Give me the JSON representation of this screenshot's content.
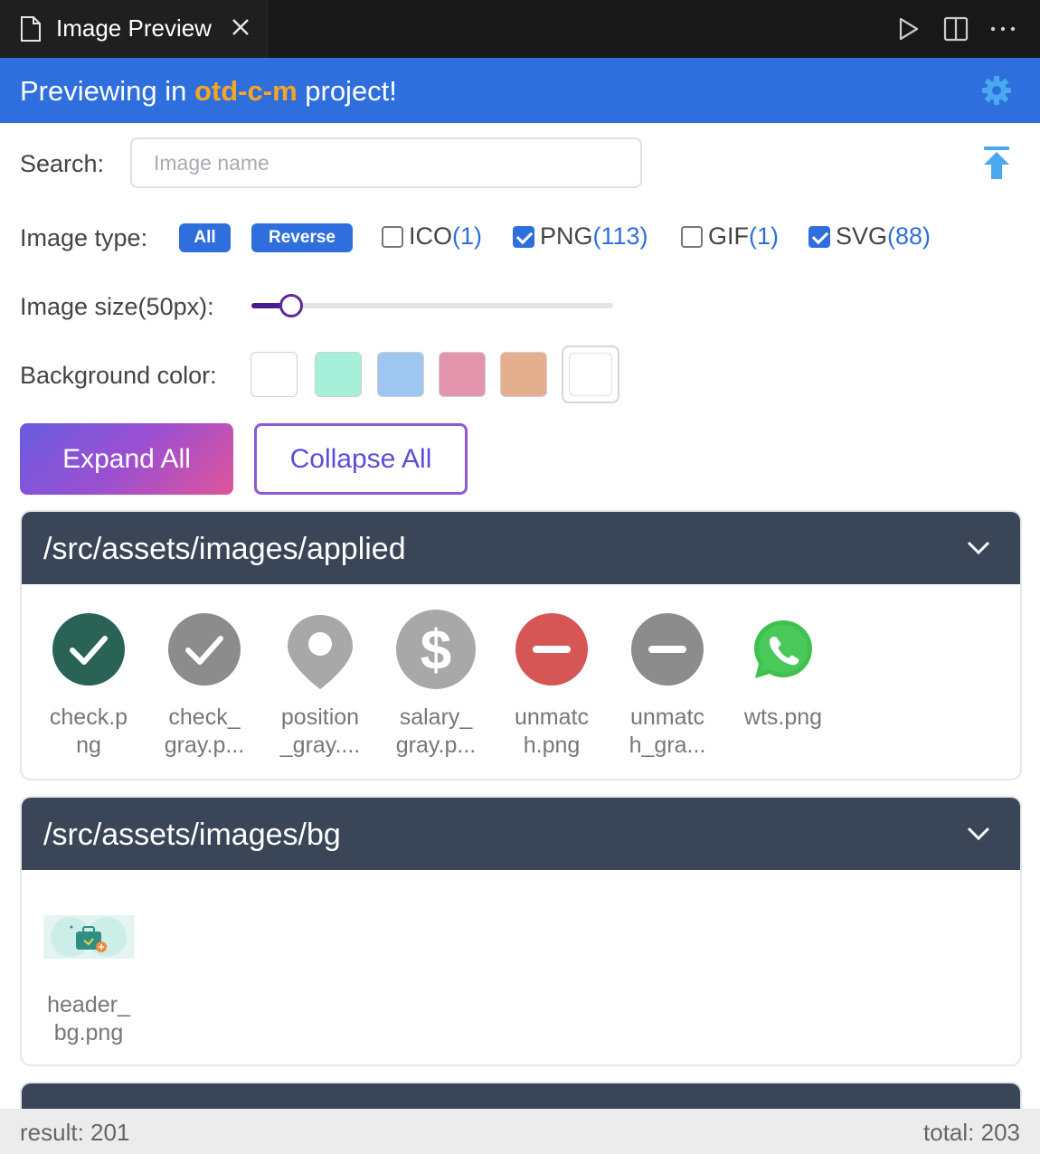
{
  "tab": {
    "title": "Image Preview"
  },
  "banner": {
    "prefix": "Previewing in ",
    "project": "otd-c-m",
    "suffix": " project!"
  },
  "search": {
    "label": "Search:",
    "placeholder": "Image name",
    "value": ""
  },
  "image_type": {
    "label": "Image type:",
    "all_label": "All",
    "reverse_label": "Reverse",
    "types": [
      {
        "name": "ICO",
        "count": "(1)",
        "checked": false
      },
      {
        "name": "PNG",
        "count": "(113)",
        "checked": true
      },
      {
        "name": "GIF",
        "count": "(1)",
        "checked": false
      },
      {
        "name": "SVG",
        "count": "(88)",
        "checked": true
      }
    ]
  },
  "image_size": {
    "label": "Image size(50px):",
    "value_fraction": 0.11
  },
  "background": {
    "label": "Background color:",
    "swatches": [
      "#ffffff",
      "#a6efd9",
      "#9ec6f0",
      "#e295ad",
      "#e5ae8f"
    ],
    "selected_swatch": "#ffffff"
  },
  "actions": {
    "expand_label": "Expand All",
    "collapse_label": "Collapse All"
  },
  "groups": [
    {
      "path": "/src/assets/images/applied",
      "images": [
        {
          "name": "check.p\nng",
          "icon": "check-circle-green-icon"
        },
        {
          "name": "check_\ngray.p...",
          "icon": "check-circle-gray-icon"
        },
        {
          "name": "position\n_gray....",
          "icon": "map-pin-gray-icon"
        },
        {
          "name": "salary_\ngray.p...",
          "icon": "dollar-circle-gray-icon"
        },
        {
          "name": "unmatc\nh.png",
          "icon": "minus-circle-red-icon"
        },
        {
          "name": "unmatc\nh_gra...",
          "icon": "minus-circle-gray-icon"
        },
        {
          "name": "wts.png",
          "icon": "whatsapp-icon"
        }
      ]
    },
    {
      "path": "/src/assets/images/bg",
      "images": [
        {
          "name": "header_\nbg.png",
          "icon": "briefcase-banner-icon"
        }
      ]
    }
  ],
  "footer": {
    "result": "result: 201",
    "total": "total: 203"
  },
  "colors": {
    "accent": "#2f6fdd",
    "banner": "#2f6fdd",
    "project_highlight": "#f6a623",
    "card_header": "#3a4658"
  }
}
